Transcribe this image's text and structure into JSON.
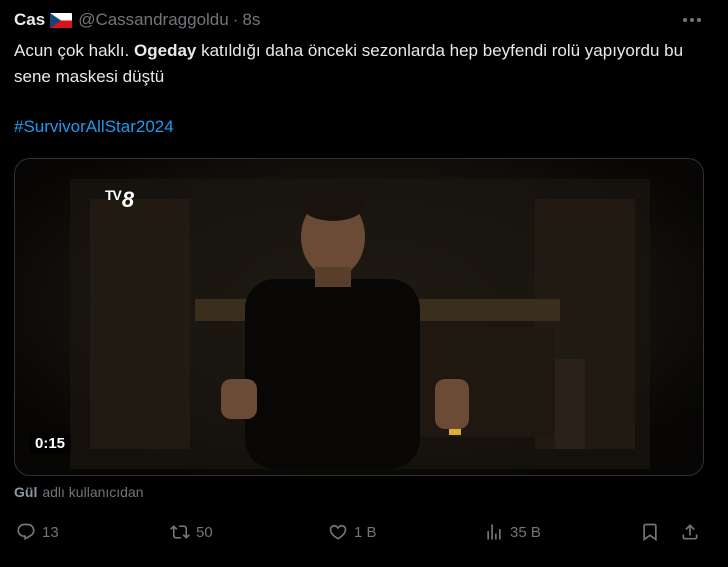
{
  "tweet": {
    "author_name": "Cas",
    "flag_icon": "czech-flag-icon",
    "handle": "@Cassandraggoldu",
    "separator": "·",
    "time": "8s",
    "text_prefix": "Acun çok haklı. ",
    "text_bold": "Ogeday",
    "text_suffix": " katıldığı daha önceki sezonlarda hep beyfendi rolü yapıyordu bu sene maskesi düştü",
    "hashtag": "#SurvivorAllStar2024"
  },
  "media": {
    "channel_logo_prefix": "TV",
    "channel_logo_suffix": "8",
    "duration": "0:15"
  },
  "source": {
    "brand": "Gül",
    "label": "adlı kullanıcıdan"
  },
  "actions": {
    "reply_count": "13",
    "repost_count": "50",
    "like_count": "1 B",
    "views_count": "35 B"
  },
  "colors": {
    "background": "#000000",
    "text": "#e7e9ea",
    "muted": "#71767b",
    "link": "#1d9bf0",
    "border": "#2f3336"
  }
}
